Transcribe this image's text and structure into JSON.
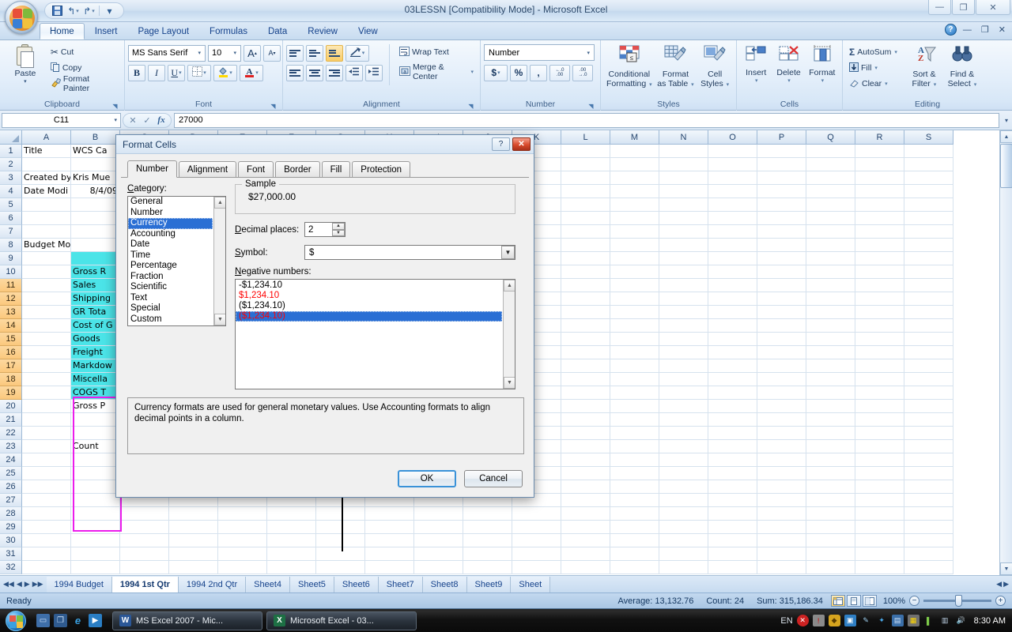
{
  "window": {
    "title": "03LESSN  [Compatibility Mode] - Microsoft Excel",
    "minimize": "—",
    "restore": "❐",
    "close": "✕"
  },
  "qat": {
    "save": "save-icon",
    "undo": "↰",
    "redo": "↱",
    "customize": "▾"
  },
  "ribbon": {
    "tabs": [
      {
        "label": "Home",
        "active": true
      },
      {
        "label": "Insert",
        "active": false
      },
      {
        "label": "Page Layout",
        "active": false
      },
      {
        "label": "Formulas",
        "active": false
      },
      {
        "label": "Data",
        "active": false
      },
      {
        "label": "Review",
        "active": false
      },
      {
        "label": "View",
        "active": false
      }
    ],
    "help": "?",
    "mini": {
      "minimize": "—",
      "restore": "❐",
      "close": "✕"
    },
    "groups": {
      "clipboard": {
        "label": "Clipboard",
        "paste": "Paste",
        "cut": "Cut",
        "copy": "Copy",
        "format_painter": "Format Painter"
      },
      "font": {
        "label": "Font",
        "font_name": "MS Sans Serif",
        "font_size": "10",
        "grow": "A",
        "shrink": "A",
        "bold": "B",
        "italic": "I",
        "underline": "U",
        "borders": "borders-icon",
        "fill_color": "fill-color-icon",
        "font_color": "A"
      },
      "alignment": {
        "label": "Alignment",
        "align_top": "align-top-icon",
        "align_middle": "align-middle-icon",
        "align_bottom": "align-bottom-icon",
        "orientation": "orientation-icon",
        "align_left": "align-left-icon",
        "align_center": "align-center-icon",
        "align_right": "align-right-icon",
        "decrease_indent": "decrease-indent-icon",
        "increase_indent": "increase-indent-icon",
        "wrap_text": "Wrap Text",
        "merge_center": "Merge & Center"
      },
      "number": {
        "label": "Number",
        "format": "Number",
        "currency": "$",
        "percent": "%",
        "comma": ",",
        "increase_decimal": "increase-decimal-icon",
        "decrease_decimal": "decrease-decimal-icon"
      },
      "styles": {
        "label": "Styles",
        "conditional_formatting": "Conditional\nFormatting",
        "conditional_formatting_l1": "Conditional",
        "conditional_formatting_l2": "Formatting",
        "format_as_table_l1": "Format",
        "format_as_table_l2": "as Table",
        "cell_styles_l1": "Cell",
        "cell_styles_l2": "Styles"
      },
      "cells": {
        "label": "Cells",
        "insert": "Insert",
        "delete": "Delete",
        "format": "Format"
      },
      "editing": {
        "label": "Editing",
        "autosum": "AutoSum",
        "fill": "Fill",
        "clear": "Clear",
        "sort_filter_l1": "Sort &",
        "sort_filter_l2": "Filter",
        "find_select_l1": "Find &",
        "find_select_l2": "Select"
      }
    }
  },
  "formula_bar": {
    "name_box": "C11",
    "cancel": "✕",
    "enter": "✓",
    "fx": "fx",
    "value": "27000",
    "expand": "▾"
  },
  "grid": {
    "column_headers": [
      "A",
      "B",
      "C",
      "D",
      "E",
      "F",
      "G",
      "H",
      "I",
      "J",
      "K",
      "L",
      "M",
      "N",
      "O",
      "P",
      "Q",
      "R",
      "S"
    ],
    "row_numbers": [
      1,
      2,
      3,
      4,
      5,
      6,
      7,
      8,
      9,
      10,
      11,
      12,
      13,
      14,
      15,
      16,
      17,
      18,
      19,
      20,
      21,
      22,
      23,
      24,
      25,
      26,
      27,
      28,
      29,
      30,
      31,
      32
    ],
    "selected_rows": [
      11,
      12,
      13,
      14,
      15,
      16,
      17,
      18,
      19
    ],
    "cells": [
      {
        "row": 1,
        "col": "A",
        "value": "Title"
      },
      {
        "row": 1,
        "col": "B",
        "value": "WCS Ca"
      },
      {
        "row": 3,
        "col": "A",
        "value": "Created by"
      },
      {
        "row": 3,
        "col": "B",
        "value": "Kris Mue"
      },
      {
        "row": 4,
        "col": "A",
        "value": "Date Modi"
      },
      {
        "row": 4,
        "col": "B",
        "value": "8/4/09",
        "align": "right"
      },
      {
        "row": 8,
        "col": "A",
        "value": "Budget Model Area"
      },
      {
        "row": 10,
        "col": "B",
        "value": "Gross R"
      },
      {
        "row": 11,
        "col": "B",
        "value": "Sales"
      },
      {
        "row": 12,
        "col": "B",
        "value": "Shipping"
      },
      {
        "row": 13,
        "col": "B",
        "value": "GR Tota"
      },
      {
        "row": 14,
        "col": "B",
        "value": "Cost of G"
      },
      {
        "row": 15,
        "col": "B",
        "value": "Goods"
      },
      {
        "row": 16,
        "col": "B",
        "value": "Freight"
      },
      {
        "row": 17,
        "col": "B",
        "value": "Markdow"
      },
      {
        "row": 18,
        "col": "B",
        "value": "Miscella"
      },
      {
        "row": 19,
        "col": "B",
        "value": "COGS T"
      },
      {
        "row": 20,
        "col": "B",
        "value": "Gross P"
      },
      {
        "row": 23,
        "col": "B",
        "value": "Count"
      }
    ]
  },
  "dialog": {
    "title": "Format Cells",
    "help_btn": "?",
    "close_btn": "✕",
    "tabs": [
      {
        "label": "Number",
        "active": true
      },
      {
        "label": "Alignment",
        "active": false
      },
      {
        "label": "Font",
        "active": false
      },
      {
        "label": "Border",
        "active": false
      },
      {
        "label": "Fill",
        "active": false
      },
      {
        "label": "Protection",
        "active": false
      }
    ],
    "category_label": "Category:",
    "categories": [
      {
        "label": "General",
        "selected": false
      },
      {
        "label": "Number",
        "selected": false
      },
      {
        "label": "Currency",
        "selected": true
      },
      {
        "label": "Accounting",
        "selected": false
      },
      {
        "label": "Date",
        "selected": false
      },
      {
        "label": "Time",
        "selected": false
      },
      {
        "label": "Percentage",
        "selected": false
      },
      {
        "label": "Fraction",
        "selected": false
      },
      {
        "label": "Scientific",
        "selected": false
      },
      {
        "label": "Text",
        "selected": false
      },
      {
        "label": "Special",
        "selected": false
      },
      {
        "label": "Custom",
        "selected": false
      }
    ],
    "sample_legend": "Sample",
    "sample_value": "$27,000.00",
    "decimal_label": "Decimal places:",
    "decimal_value": "2",
    "symbol_label": "Symbol:",
    "symbol_value": "$",
    "negative_label": "Negative numbers:",
    "negative_options": [
      {
        "text": "-$1,234.10",
        "color": "#000000",
        "selected": false
      },
      {
        "text": "$1,234.10",
        "color": "#ff0000",
        "selected": false
      },
      {
        "text": "($1,234.10)",
        "color": "#000000",
        "selected": false
      },
      {
        "text": "($1,234.10)",
        "color": "#ff0000",
        "selected": true
      }
    ],
    "description": "Currency formats are used for general monetary values.  Use Accounting formats to align decimal points in a column.",
    "ok": "OK",
    "cancel": "Cancel"
  },
  "sheet_tabs": {
    "nav": {
      "first": "◀◀",
      "prev": "◀",
      "next": "▶",
      "last": "▶▶"
    },
    "tabs": [
      {
        "label": "1994 Budget",
        "active": false
      },
      {
        "label": "1994 1st Qtr",
        "active": true
      },
      {
        "label": "1994 2nd Qtr",
        "active": false
      },
      {
        "label": "Sheet4",
        "active": false
      },
      {
        "label": "Sheet5",
        "active": false
      },
      {
        "label": "Sheet6",
        "active": false
      },
      {
        "label": "Sheet7",
        "active": false
      },
      {
        "label": "Sheet8",
        "active": false
      },
      {
        "label": "Sheet9",
        "active": false
      },
      {
        "label": "Sheet",
        "active": false
      }
    ]
  },
  "status_bar": {
    "mode": "Ready",
    "average": "Average: 13,132.76",
    "count": "Count: 24",
    "sum": "Sum: 315,186.34",
    "view_normal": "normal-view-icon",
    "view_page_layout": "page-layout-view-icon",
    "view_page_break": "page-break-view-icon",
    "zoom": "100%",
    "zoom_out": "−",
    "zoom_in": "+"
  },
  "taskbar": {
    "start": "start-orb-icon",
    "quick_launch": [
      "show-desktop-icon",
      "switch-windows-icon",
      "internet-explorer-icon",
      "media-player-icon"
    ],
    "items": [
      {
        "label": "MS Excel 2007 - Mic...",
        "icon": "word-icon"
      },
      {
        "label": "Microsoft Excel - 03...",
        "icon": "excel-icon"
      }
    ],
    "language": "EN",
    "clock": "8:30 AM"
  }
}
